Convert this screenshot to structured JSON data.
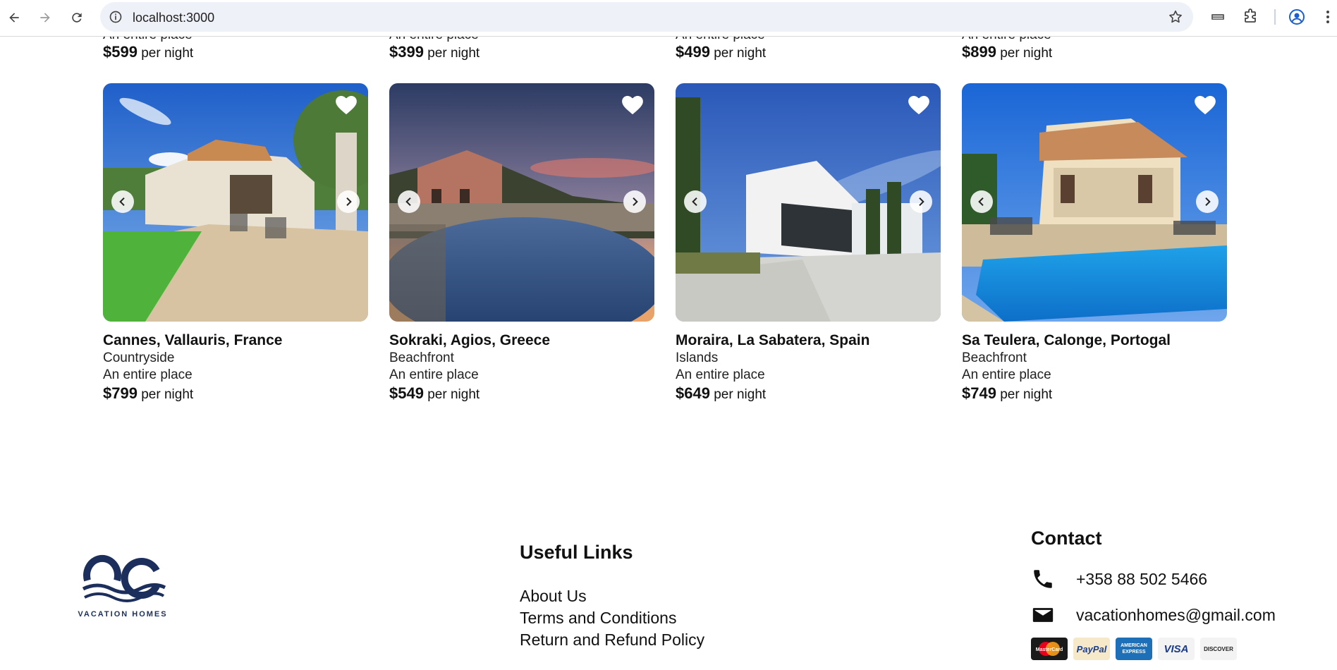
{
  "browser": {
    "url": "localhost:3000"
  },
  "partial_row": [
    {
      "type": "An entire place",
      "price": "$599",
      "unit": "per night"
    },
    {
      "type": "An entire place",
      "price": "$399",
      "unit": "per night"
    },
    {
      "type": "An entire place",
      "price": "$499",
      "unit": "per night"
    },
    {
      "type": "An entire place",
      "price": "$899",
      "unit": "per night"
    }
  ],
  "listings": [
    {
      "title": "Cannes, Vallauris, France",
      "category": "Countryside",
      "type": "An entire place",
      "price": "$799",
      "unit": "per night"
    },
    {
      "title": "Sokraki, Agios, Greece",
      "category": "Beachfront",
      "type": "An entire place",
      "price": "$549",
      "unit": "per night"
    },
    {
      "title": "Moraira, La Sabatera, Spain",
      "category": "Islands",
      "type": "An entire place",
      "price": "$649",
      "unit": "per night"
    },
    {
      "title": "Sa Teulera, Calonge, Portogal",
      "category": "Beachfront",
      "type": "An entire place",
      "price": "$749",
      "unit": "per night"
    }
  ],
  "footer": {
    "logo_text": "VACATION HOMES",
    "links_title": "Useful Links",
    "links": [
      "About Us",
      "Terms and Conditions",
      "Return and Refund Policy"
    ],
    "contact_title": "Contact",
    "phone": "+358 88 502 5466",
    "email": "vacationhomes@gmail.com",
    "payment_methods": [
      "MasterCard",
      "PayPal",
      "AMERICAN EXPRESS",
      "VISA",
      "DISCOVER"
    ]
  },
  "colors": {
    "brand_navy": "#1c2f5c",
    "text": "#111111"
  }
}
